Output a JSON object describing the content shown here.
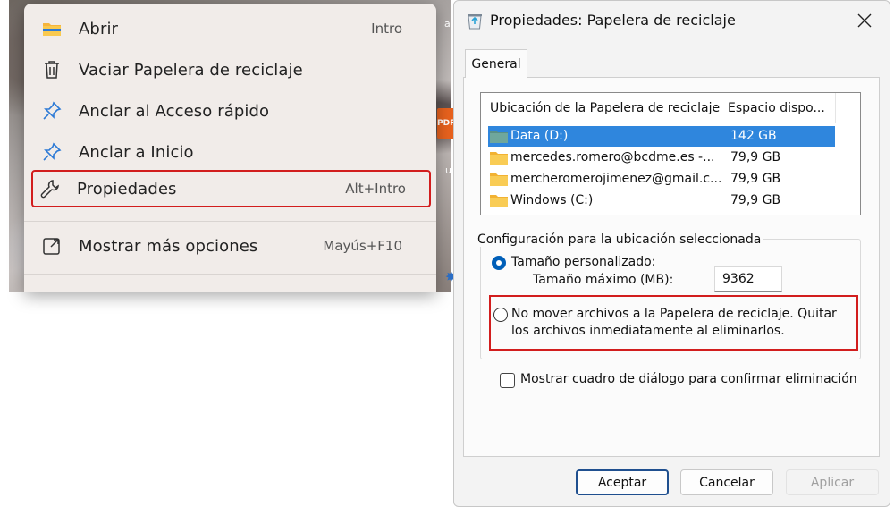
{
  "context_menu": {
    "items": [
      {
        "label": "Abrir",
        "shortcut": "Intro",
        "icon": "folder-icon"
      },
      {
        "label": "Vaciar Papelera de reciclaje",
        "shortcut": "",
        "icon": "trash-icon"
      },
      {
        "label": "Anclar al Acceso rápido",
        "shortcut": "",
        "icon": "pin-icon"
      },
      {
        "label": "Anclar a Inicio",
        "shortcut": "",
        "icon": "pin-icon"
      },
      {
        "label": "Propiedades",
        "shortcut": "Alt+Intro",
        "icon": "wrench-icon",
        "highlighted": true
      },
      {
        "label": "Mostrar más opciones",
        "shortcut": "Mayús+F10",
        "icon": "share-icon"
      }
    ],
    "desktop_fragments": {
      "pdf_badge": "PDF",
      "fragment_top": "as",
      "fragment_mid": "utu"
    }
  },
  "dialog": {
    "title": "Propiedades: Papelera de reciclaje",
    "tab": "General",
    "list": {
      "col_location": "Ubicación de la Papelera de reciclaje",
      "col_space": "Espacio dispo...",
      "rows": [
        {
          "name": "Data (D:)",
          "space": "142 GB",
          "selected": true
        },
        {
          "name": "mercedes.romero@bcdme.es -...",
          "space": "79,9 GB"
        },
        {
          "name": "mercheromerojimenez@gmail.c...",
          "space": "79,9 GB"
        },
        {
          "name": "Windows (C:)",
          "space": "79,9 GB"
        }
      ]
    },
    "group_title": "Configuración para la ubicación seleccionada",
    "custom_size_label": "Tamaño personalizado:",
    "max_size_label": "Tamaño máximo (MB):",
    "max_size_value": "9362",
    "no_move_line1": "No mover archivos a la Papelera de reciclaje. Quitar",
    "no_move_line2": "los archivos inmediatamente al eliminarlos.",
    "confirm_label": "Mostrar cuadro de diálogo para confirmar eliminación",
    "buttons": {
      "ok": "Aceptar",
      "cancel": "Cancelar",
      "apply": "Aplicar"
    }
  },
  "colors": {
    "selection": "#2f86dd",
    "highlight_border": "#d21d1d",
    "primary_border": "#1f4f8f"
  }
}
